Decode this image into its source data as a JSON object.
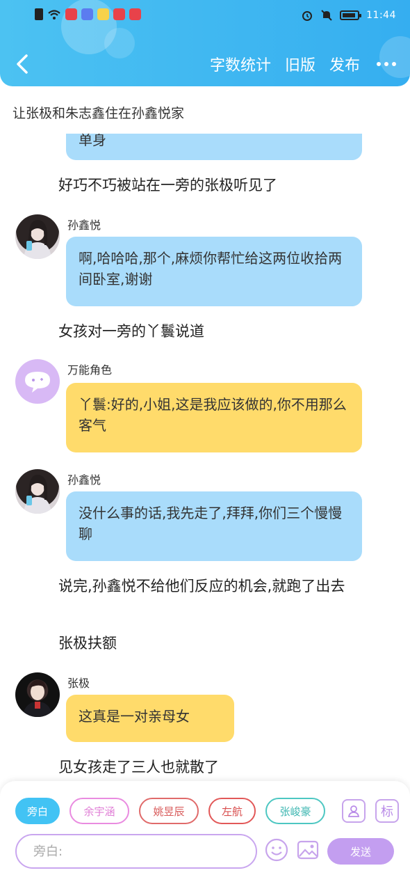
{
  "status_bar": {
    "time": "11:44"
  },
  "header": {
    "actions": [
      "字数统计",
      "旧版",
      "发布"
    ]
  },
  "chapter_title": "让张极和朱志鑫住在孙鑫悦家",
  "messages": [
    {
      "type": "bubble",
      "style": "blue",
      "text": "单身"
    },
    {
      "type": "narration",
      "text": "好巧不巧被站在一旁的张极听见了"
    },
    {
      "type": "bubble",
      "style": "blue",
      "speaker": "孙鑫悦",
      "text": "啊,哈哈哈,那个,麻烦你帮忙给这两位收拾两间卧室,谢谢"
    },
    {
      "type": "narration",
      "text": "女孩对一旁的丫鬟说道"
    },
    {
      "type": "bubble",
      "style": "yellow",
      "speaker": "万能角色",
      "text": "丫鬟:好的,小姐,这是我应该做的,你不用那么客气"
    },
    {
      "type": "bubble",
      "style": "blue",
      "speaker": "孙鑫悦",
      "text": "没什么事的话,我先走了,拜拜,你们三个慢慢聊"
    },
    {
      "type": "narration",
      "text": "说完,孙鑫悦不给他们反应的机会,就跑了出去"
    },
    {
      "type": "narration",
      "text": "张极扶额"
    },
    {
      "type": "bubble",
      "style": "yellow",
      "speaker": "张极",
      "text": "这真是一对亲母女"
    },
    {
      "type": "narration",
      "text": "见女孩走了三人也就散了"
    }
  ],
  "role_chips": [
    {
      "label": "旁白",
      "color": "#42c3f4"
    },
    {
      "label": "余宇涵",
      "color": "#e98be0"
    },
    {
      "label": "姚昱辰",
      "color": "#e06a6a"
    },
    {
      "label": "左航",
      "color": "#e25858"
    },
    {
      "label": "张峻豪",
      "color": "#4dc7c2"
    }
  ],
  "input": {
    "placeholder": "旁白:"
  },
  "send_label": "发送",
  "tag_label": "标"
}
